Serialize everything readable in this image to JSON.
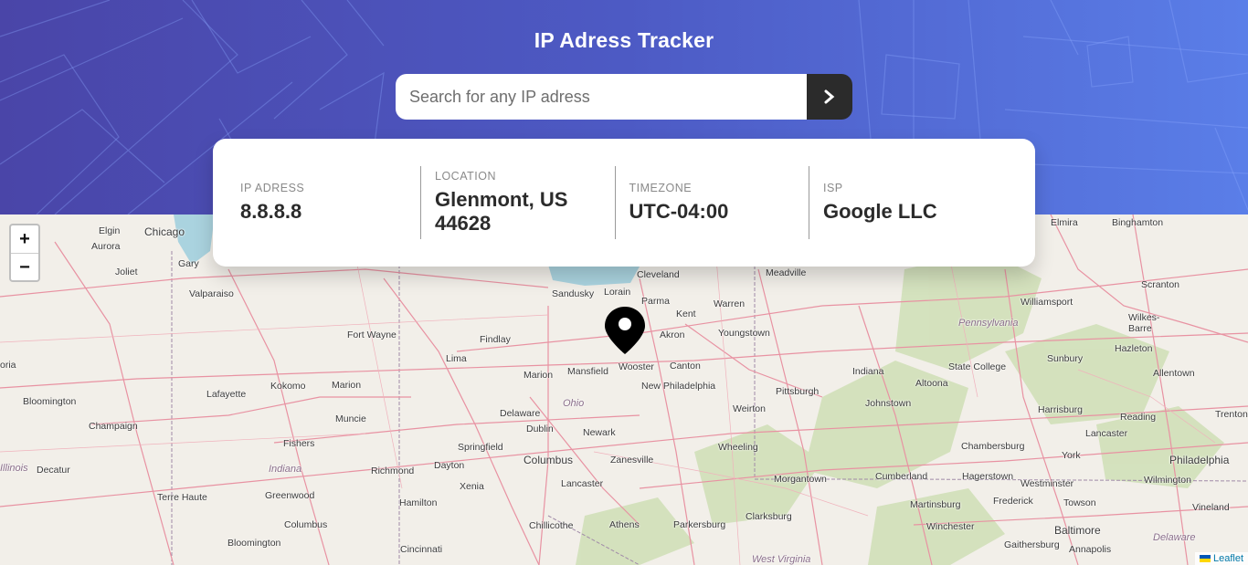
{
  "header": {
    "title": "IP Adress Tracker",
    "search_placeholder": "Search for any IP adress",
    "search_button_icon": "chevron-right-icon"
  },
  "info": {
    "ip_label": "IP ADRESS",
    "ip_value": "8.8.8.8",
    "location_label": "LOCATION",
    "location_value": "Glenmont, US 44628",
    "timezone_label": "TIMEZONE",
    "timezone_value": "UTC-04:00",
    "isp_label": "ISP",
    "isp_value": "Google LLC"
  },
  "map": {
    "zoom_in": "+",
    "zoom_out": "−",
    "attribution": "Leaflet",
    "labels": {
      "chicago": "Chicago",
      "elgin": "Elgin",
      "aurora": "Aurora",
      "joliet": "Joliet",
      "gary": "Gary",
      "valparaiso": "Valparaiso",
      "fort_wayne": "Fort Wayne",
      "findlay": "Findlay",
      "lima": "Lima",
      "sandusky": "Sandusky",
      "lorain": "Lorain",
      "cleveland": "Cleveland",
      "parma": "Parma",
      "kent": "Kent",
      "akron": "Akron",
      "warren": "Warren",
      "youngstown": "Youngstown",
      "meadville": "Meadville",
      "mansfield": "Mansfield",
      "wooster": "Wooster",
      "canton": "Canton",
      "marion": "Marion",
      "new_philadelphia": "New Philadelphia",
      "kokomo": "Kokomo",
      "marion_in": "Marion",
      "lafayette": "Lafayette",
      "bloomington_il": "Bloomington",
      "champaign": "Champaign",
      "muncie": "Muncie",
      "ohio": "Ohio",
      "delaware": "Delaware",
      "dublin": "Dublin",
      "newark": "Newark",
      "columbus": "Columbus",
      "springfield": "Springfield",
      "dayton": "Dayton",
      "xenia": "Xenia",
      "zanesville": "Zanesville",
      "fishers": "Fishers",
      "indiana_state": "Indiana",
      "richmond": "Richmond",
      "decatur": "Decatur",
      "illinois": "Illinois",
      "terre_haute": "Terre Haute",
      "greenwood": "Greenwood",
      "columbus_in": "Columbus",
      "bloomington_in": "Bloomington",
      "hamilton": "Hamilton",
      "cincinnati": "Cincinnati",
      "lancaster_oh": "Lancaster",
      "chillicothe": "Chillicothe",
      "athens": "Athens",
      "parkersburg": "Parkersburg",
      "wheeling": "Wheeling",
      "weirton": "Weirton",
      "pittsburgh": "Pittsburgh",
      "morgantown": "Morgantown",
      "clarksburg": "Clarksburg",
      "west_virginia": "West Virginia",
      "indiana_pa": "Indiana",
      "johnstown": "Johnstown",
      "altoona": "Altoona",
      "state_college": "State College",
      "cumberland": "Cumberland",
      "hagerstown": "Hagerstown",
      "martinsburg": "Martinsburg",
      "winchester": "Winchester",
      "frederick": "Frederick",
      "chambersburg": "Chambersburg",
      "westminster": "Westminster",
      "towson": "Towson",
      "baltimore": "Baltimore",
      "annapolis": "Annapolis",
      "gaithersburg": "Gaithersburg",
      "york": "York",
      "lancaster_pa": "Lancaster",
      "harrisburg": "Harrisburg",
      "reading": "Reading",
      "philadelphia": "Philadelphia",
      "wilmington": "Wilmington",
      "vineland": "Vineland",
      "delaware_state": "Delaware",
      "trenton": "Trenton",
      "allentown": "Allentown",
      "hazleton": "Hazleton",
      "sunbury": "Sunbury",
      "williamsport": "Williamsport",
      "pennsylvania": "Pennsylvania",
      "wilkes_barre": "Wilkes-\nBarre",
      "scranton": "Scranton",
      "elmira": "Elmira",
      "binghamton": "Binghamton",
      "ora": "oria"
    }
  },
  "colors": {
    "header_start": "#4a45a8",
    "header_end": "#5a7ee8",
    "dark": "#2b2b2b",
    "label_gray": "#8a8a8a",
    "map_bg": "#f2efe9",
    "road": "#e892a2",
    "lake": "#aad3df",
    "forest": "#c8dbb0"
  }
}
